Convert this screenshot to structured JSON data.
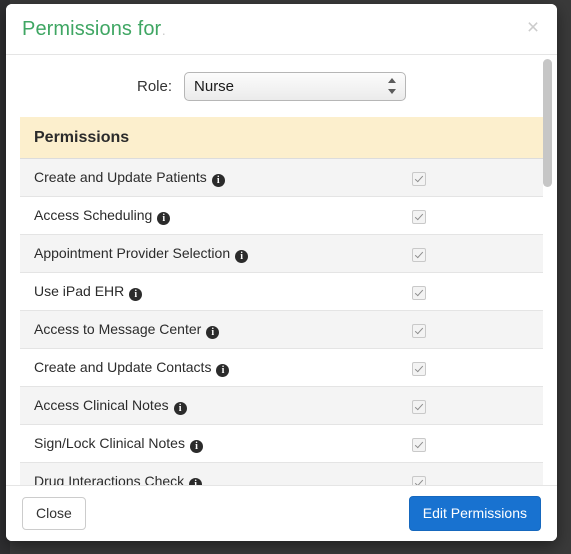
{
  "modal": {
    "title_text": "Permissions for",
    "title_redacted": "․",
    "close_icon": "close-icon",
    "close_glyph": "×",
    "accent_title_color": "#3fa663",
    "primary_button_color": "#1872d0",
    "header_band_color": "#fcefcd"
  },
  "role": {
    "label": "Role:",
    "selected": "Nurse",
    "options": [
      "Nurse"
    ]
  },
  "table": {
    "header": "Permissions",
    "info_glyph": "i",
    "rows": [
      {
        "label": "Create and Update Patients",
        "checked": true
      },
      {
        "label": "Access Scheduling",
        "checked": true
      },
      {
        "label": "Appointment Provider Selection",
        "checked": true
      },
      {
        "label": "Use iPad EHR",
        "checked": true
      },
      {
        "label": "Access to Message Center",
        "checked": true
      },
      {
        "label": "Create and Update Contacts",
        "checked": true
      },
      {
        "label": "Access Clinical Notes",
        "checked": true
      },
      {
        "label": "Sign/Lock Clinical Notes",
        "checked": true
      },
      {
        "label": "Drug Interactions Check",
        "checked": true
      }
    ]
  },
  "footer": {
    "close_label": "Close",
    "edit_label": "Edit Permissions"
  }
}
